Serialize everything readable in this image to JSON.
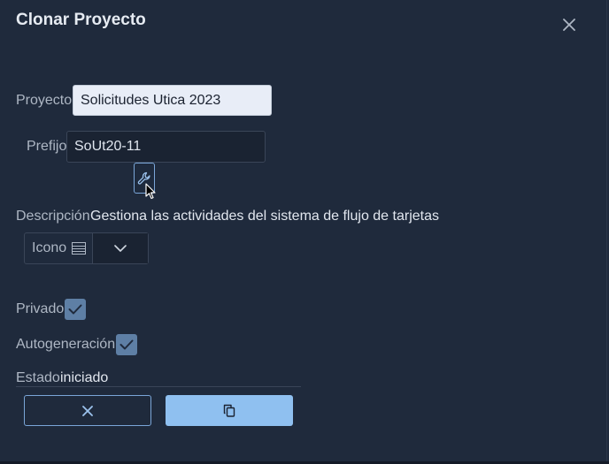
{
  "dialog": {
    "title": "Clonar Proyecto",
    "close_icon": "close-icon"
  },
  "form": {
    "project_label": "Proyecto",
    "project_value": "Solicitudes Utica 2023",
    "prefix_label": "Prefijo",
    "prefix_value": "SoUt20-11",
    "generate_prefix_icon": "wrench-icon",
    "description_label": "Descripción",
    "description_value": "Gestiona las actividades del sistema de flujo de tarjetas",
    "icon_label": "Icono",
    "icon_glyph": "list-icon",
    "private_label": "Privado",
    "private_checked": true,
    "autogen_label": "Autogeneración",
    "autogen_checked": true,
    "status_label": "Estado",
    "status_value": "iniciado"
  },
  "actions": {
    "cancel_icon": "close-icon",
    "clone_icon": "copy-icon"
  },
  "colors": {
    "background": "#1f2a3c",
    "accent": "#8fc0f0",
    "checkbox": "#5e7fa5"
  }
}
